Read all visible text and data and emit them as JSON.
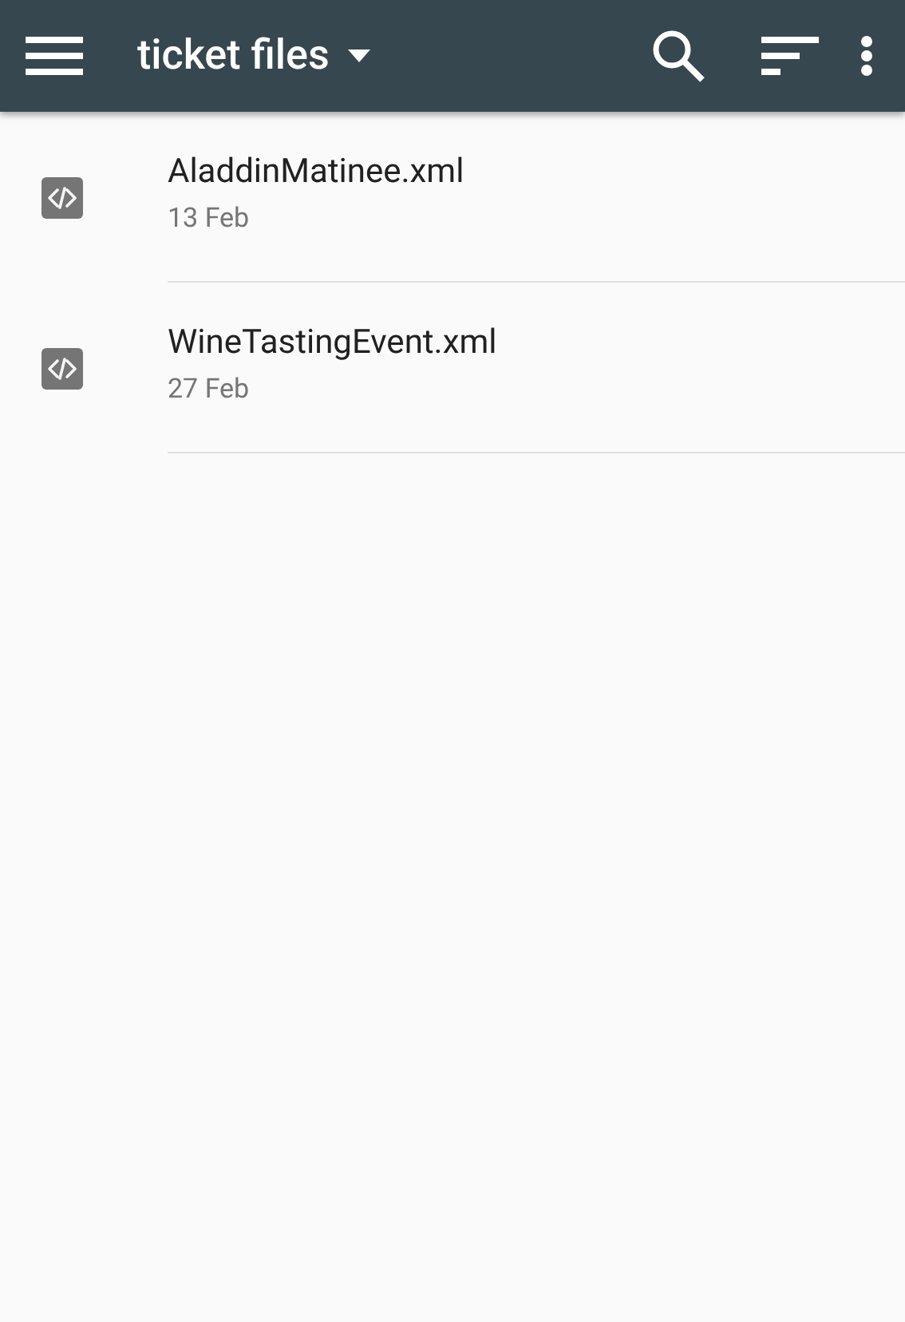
{
  "toolbar": {
    "title": "ticket files"
  },
  "files": [
    {
      "name": "AladdinMatinee.xml",
      "date": "13 Feb"
    },
    {
      "name": "WineTastingEvent.xml",
      "date": "27 Feb"
    }
  ]
}
